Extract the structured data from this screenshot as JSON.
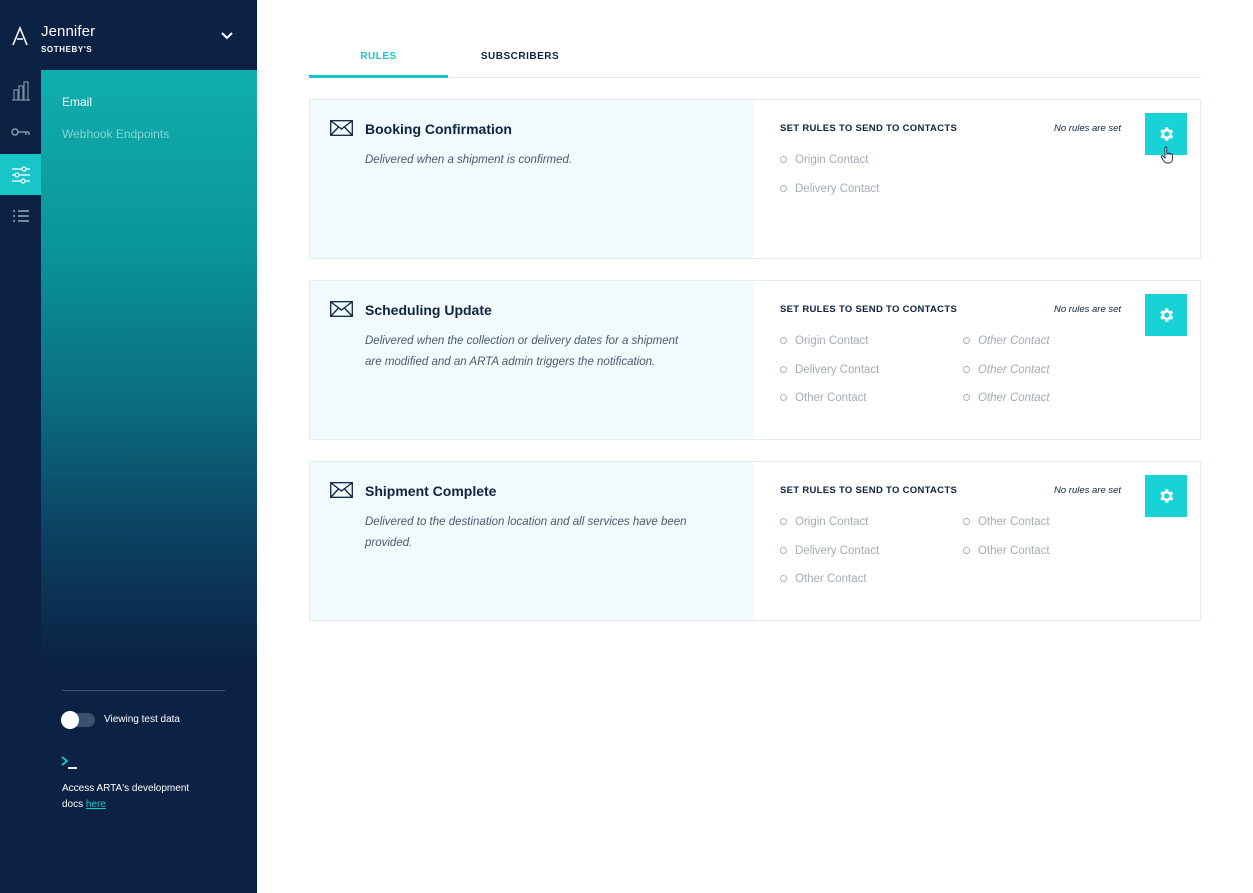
{
  "account": {
    "name": "Jennifer",
    "org": "SOTHEBY'S"
  },
  "rail": [
    {
      "icon": "analytics-icon",
      "active": false
    },
    {
      "icon": "key-icon",
      "active": false
    },
    {
      "icon": "sliders-icon",
      "active": true
    },
    {
      "icon": "list-icon",
      "active": false
    }
  ],
  "subnav": {
    "email": "Email",
    "webhooks": "Webhook Endpoints"
  },
  "footer": {
    "toggle_label": "Viewing test data",
    "docs_text": "Access ARTA's development docs",
    "docs_link": "here"
  },
  "tabs": {
    "rules": "RULES",
    "subscribers": "SUBSCRIBERS"
  },
  "colors": {
    "accent": "#18c6c8",
    "navy": "#0b2244",
    "card_bg": "#f1fafd"
  },
  "cards": [
    {
      "title": "Booking Confirmation",
      "description": "Delivered when a shipment is confirmed.",
      "rules_heading": "SET RULES TO SEND TO CONTACTS",
      "status": "No rules are set",
      "contacts_left": [
        "Origin Contact",
        "Delivery Contact"
      ],
      "contacts_right": []
    },
    {
      "title": "Scheduling Update",
      "description": "Delivered when the collection or delivery dates for a shipment are modified and an ARTA admin triggers the notification.",
      "rules_heading": "SET RULES TO SEND TO CONTACTS",
      "status": "No rules are set",
      "contacts_left": [
        "Origin Contact",
        "Delivery Contact",
        "Other Contact"
      ],
      "contacts_right": [
        "Other Contact",
        "Other Contact",
        "Other Contact"
      ]
    },
    {
      "title": "Shipment Complete",
      "description": "Delivered to the destination location and all services have been provided.",
      "rules_heading": "SET RULES TO SEND TO CONTACTS",
      "status": "No rules are set",
      "contacts_left": [
        "Origin Contact",
        "Delivery Contact",
        "Other Contact"
      ],
      "contacts_right": [
        "Other Contact",
        "Other Contact"
      ]
    }
  ]
}
